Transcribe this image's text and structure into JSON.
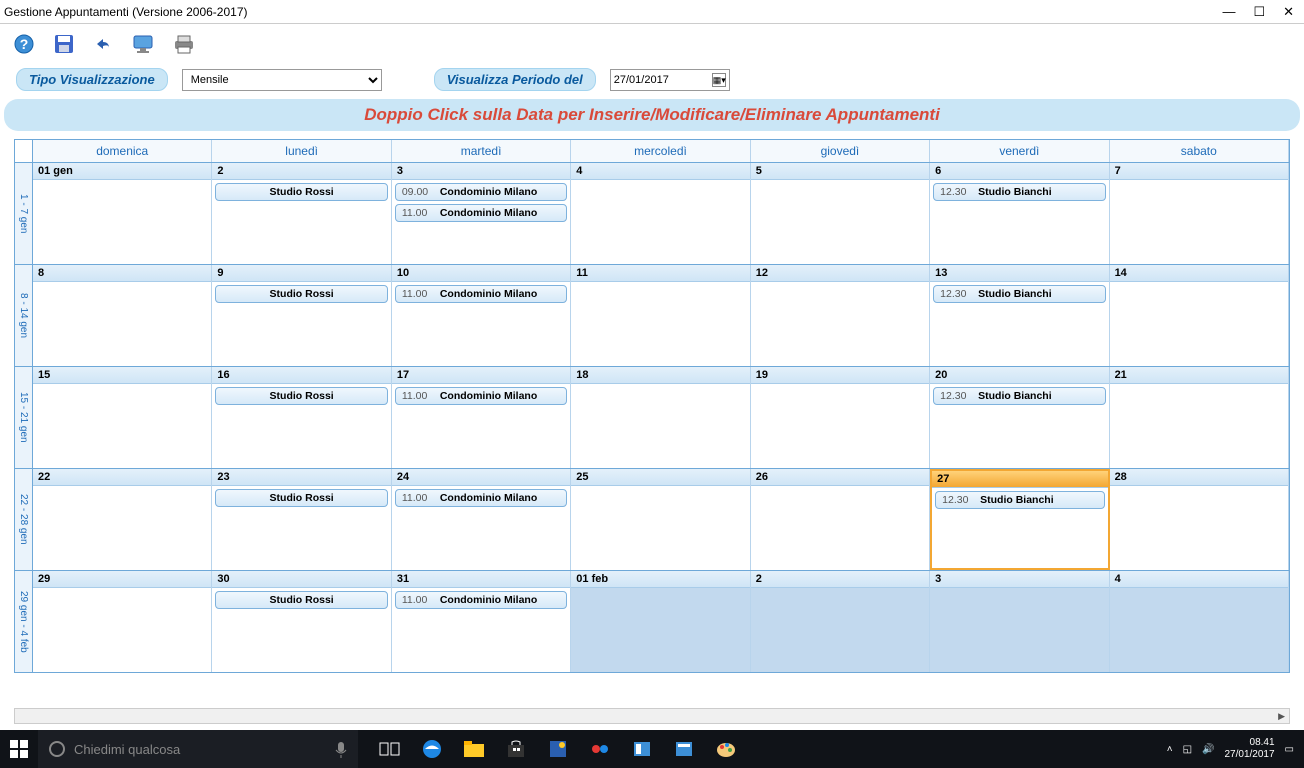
{
  "window": {
    "title": "Gestione Appuntamenti (Versione 2006-2017)"
  },
  "labels": {
    "viewType": "Tipo Visualizzazione",
    "viewPeriod": "Visualizza Periodo del",
    "hint": "Doppio Click sulla Data per Inserire/Modificare/Eliminare Appuntamenti"
  },
  "controls": {
    "viewMode": "Mensile",
    "date": "27/01/2017"
  },
  "dayHeaders": [
    "domenica",
    "lunedì",
    "martedì",
    "mercoledì",
    "giovedì",
    "venerdì",
    "sabato"
  ],
  "weeks": [
    {
      "label": "1 - 7 gen",
      "days": [
        {
          "date": "01 gen",
          "appts": []
        },
        {
          "date": "2",
          "appts": [
            {
              "time": "",
              "label": "Studio Rossi"
            }
          ]
        },
        {
          "date": "3",
          "appts": [
            {
              "time": "09.00",
              "label": "Condominio Milano"
            },
            {
              "time": "11.00",
              "label": "Condominio Milano"
            }
          ]
        },
        {
          "date": "4",
          "appts": []
        },
        {
          "date": "5",
          "appts": []
        },
        {
          "date": "6",
          "appts": [
            {
              "time": "12.30",
              "label": "Studio Bianchi"
            }
          ]
        },
        {
          "date": "7",
          "appts": []
        }
      ]
    },
    {
      "label": "8 - 14 gen",
      "days": [
        {
          "date": "8",
          "appts": []
        },
        {
          "date": "9",
          "appts": [
            {
              "time": "",
              "label": "Studio Rossi"
            }
          ]
        },
        {
          "date": "10",
          "appts": [
            {
              "time": "11.00",
              "label": "Condominio Milano"
            }
          ]
        },
        {
          "date": "11",
          "appts": []
        },
        {
          "date": "12",
          "appts": []
        },
        {
          "date": "13",
          "appts": [
            {
              "time": "12.30",
              "label": "Studio Bianchi"
            }
          ]
        },
        {
          "date": "14",
          "appts": []
        }
      ]
    },
    {
      "label": "15 - 21 gen",
      "days": [
        {
          "date": "15",
          "appts": []
        },
        {
          "date": "16",
          "appts": [
            {
              "time": "",
              "label": "Studio Rossi"
            }
          ]
        },
        {
          "date": "17",
          "appts": [
            {
              "time": "11.00",
              "label": "Condominio Milano"
            }
          ]
        },
        {
          "date": "18",
          "appts": []
        },
        {
          "date": "19",
          "appts": []
        },
        {
          "date": "20",
          "appts": [
            {
              "time": "12.30",
              "label": "Studio Bianchi"
            }
          ]
        },
        {
          "date": "21",
          "appts": []
        }
      ]
    },
    {
      "label": "22 - 28 gen",
      "days": [
        {
          "date": "22",
          "appts": []
        },
        {
          "date": "23",
          "appts": [
            {
              "time": "",
              "label": "Studio Rossi"
            }
          ]
        },
        {
          "date": "24",
          "appts": [
            {
              "time": "11.00",
              "label": "Condominio Milano"
            }
          ]
        },
        {
          "date": "25",
          "appts": []
        },
        {
          "date": "26",
          "appts": []
        },
        {
          "date": "27",
          "today": true,
          "appts": [
            {
              "time": "12.30",
              "label": "Studio Bianchi"
            }
          ]
        },
        {
          "date": "28",
          "appts": []
        }
      ]
    },
    {
      "label": "29 gen - 4 feb",
      "days": [
        {
          "date": "29",
          "appts": []
        },
        {
          "date": "30",
          "appts": [
            {
              "time": "",
              "label": "Studio Rossi"
            }
          ]
        },
        {
          "date": "31",
          "appts": [
            {
              "time": "11.00",
              "label": "Condominio Milano"
            }
          ]
        },
        {
          "date": "01 feb",
          "dim": true,
          "appts": []
        },
        {
          "date": "2",
          "dim": true,
          "appts": []
        },
        {
          "date": "3",
          "dim": true,
          "appts": []
        },
        {
          "date": "4",
          "dim": true,
          "appts": []
        }
      ]
    }
  ],
  "taskbar": {
    "search": "Chiedimi qualcosa",
    "time": "08.41",
    "date": "27/01/2017"
  }
}
